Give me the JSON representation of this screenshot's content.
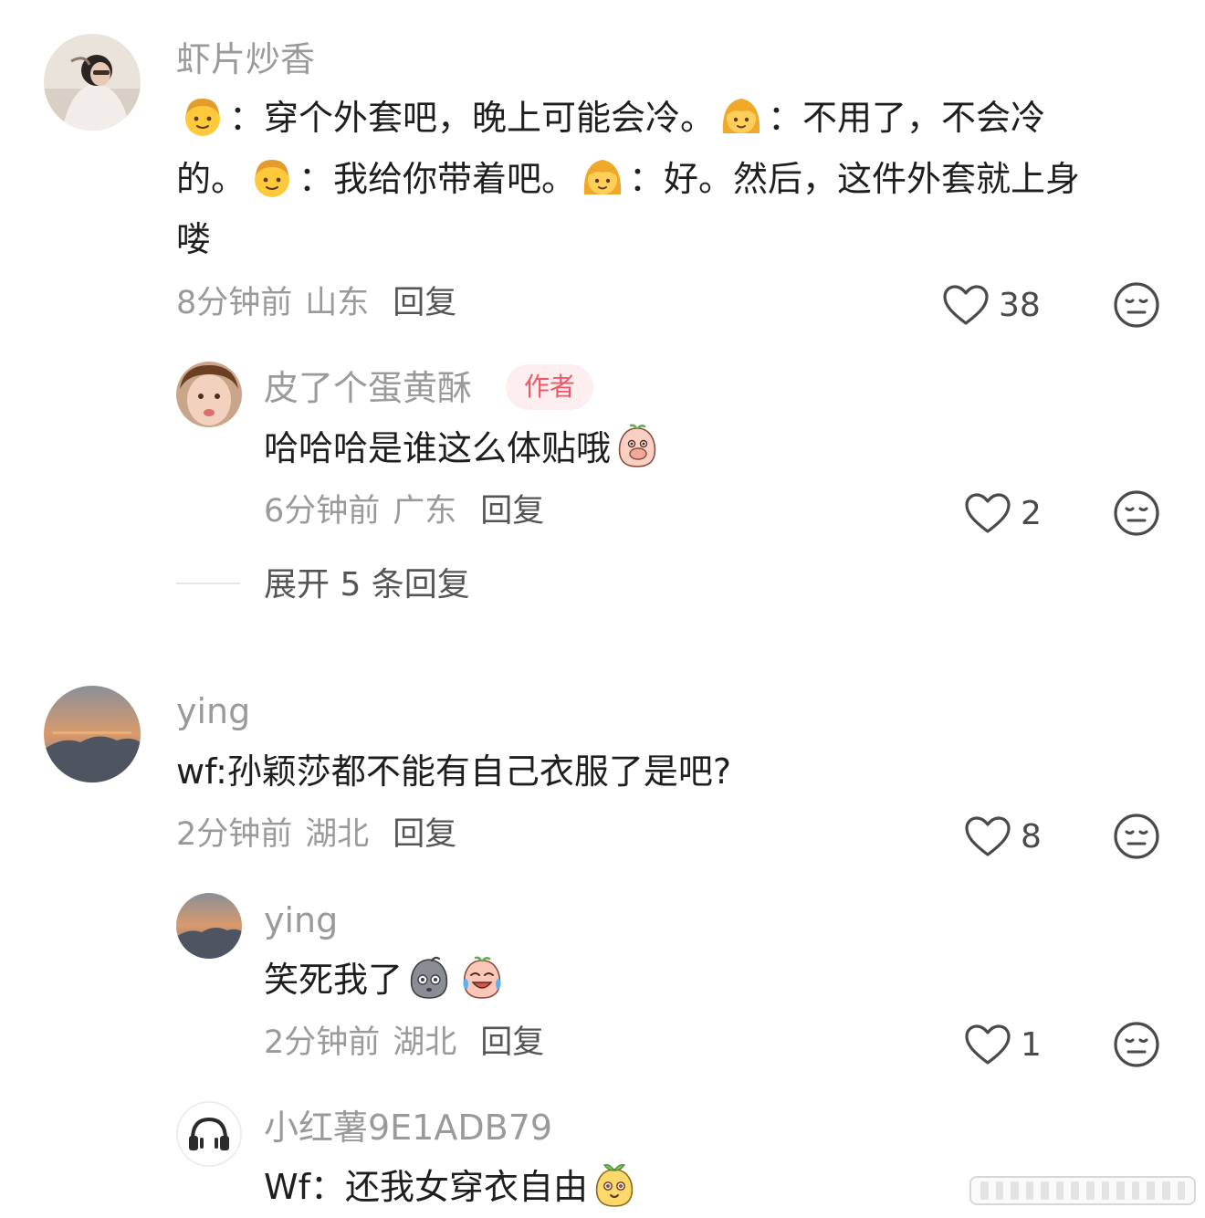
{
  "comments": [
    {
      "username": "虾片炒香",
      "text": {
        "line1": [
          "穿个外套吧，晚上可能会冷。",
          "：不用了，不会冷"
        ],
        "line2": [
          "的。",
          "：我给你带着吧。",
          "：好。然后，这件外套就上身"
        ],
        "line3": "喽",
        "boy_colon": "："
      },
      "time": "8分钟前",
      "location": "山东",
      "reply_label": "回复",
      "likes": "38",
      "replies": [
        {
          "username": "皮了个蛋黄酥",
          "badge": "作者",
          "text": "哈哈哈是谁这么体贴哦",
          "time": "6分钟前",
          "location": "广东",
          "reply_label": "回复",
          "likes": "2"
        }
      ],
      "expand_label": "展开 5 条回复"
    },
    {
      "username": "ying",
      "text": "wf:孙颖莎都不能有自己衣服了是吧?",
      "time": "2分钟前",
      "location": "湖北",
      "reply_label": "回复",
      "likes": "8",
      "replies": [
        {
          "username": "ying",
          "text": "笑死我了",
          "time": "2分钟前",
          "location": "湖北",
          "reply_label": "回复",
          "likes": "1"
        },
        {
          "username": "小红薯9E1ADB79",
          "text": "Wf：还我女穿衣自由"
        }
      ]
    }
  ],
  "icons": [
    "heart-outline-icon",
    "expressionless-face-icon",
    "boy-emoji",
    "girl-emoji",
    "covering-mouth-emoji",
    "rock-emoji",
    "crying-laughing-emoji",
    "sprout-emoji",
    "headphones-icon"
  ],
  "colors": {
    "author_badge_bg": "#fdeeef",
    "author_badge_text": "#f25566",
    "meta": "#9a9a9a"
  }
}
